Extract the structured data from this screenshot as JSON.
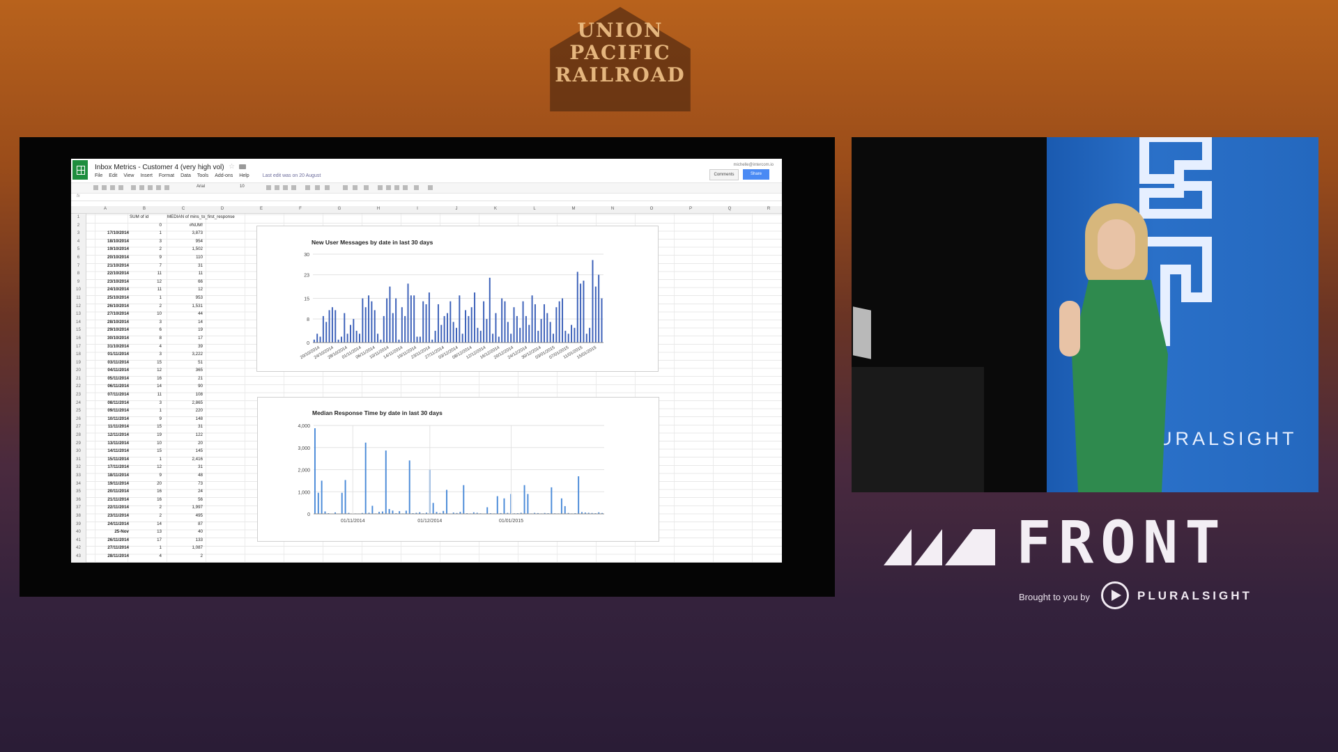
{
  "background": {
    "sign_lines": [
      "UNION",
      "PACIFIC",
      "RAILROAD"
    ]
  },
  "sheet": {
    "title": "Inbox Metrics - Customer 4 (very high vol)",
    "user": "michelle@intercom.io",
    "menu": [
      "File",
      "Edit",
      "View",
      "Insert",
      "Format",
      "Data",
      "Tools",
      "Add-ons",
      "Help"
    ],
    "last_edit": "Last edit was on 20 August",
    "comments_label": "Comments",
    "share_label": "Share",
    "font": "Arial",
    "font_size": "10",
    "fx": "fx",
    "columns": [
      "A",
      "B",
      "C",
      "D",
      "E",
      "F",
      "G",
      "H",
      "I",
      "J",
      "K",
      "L",
      "M",
      "N",
      "O",
      "P",
      "Q",
      "R"
    ],
    "header_b": "SUM of id",
    "header_c": "MEDIAN of mins_to_first_response",
    "rows": [
      {
        "n": "1",
        "a": "",
        "b": "",
        "c": ""
      },
      {
        "n": "2",
        "a": "",
        "b": "0",
        "c": "#NUM!"
      },
      {
        "n": "3",
        "a": "17/10/2014",
        "b": "1",
        "c": "3,873"
      },
      {
        "n": "4",
        "a": "18/10/2014",
        "b": "3",
        "c": "954"
      },
      {
        "n": "5",
        "a": "19/10/2014",
        "b": "2",
        "c": "1,502"
      },
      {
        "n": "6",
        "a": "20/10/2014",
        "b": "9",
        "c": "110"
      },
      {
        "n": "7",
        "a": "21/10/2014",
        "b": "7",
        "c": "31"
      },
      {
        "n": "8",
        "a": "22/10/2014",
        "b": "11",
        "c": "11"
      },
      {
        "n": "9",
        "a": "23/10/2014",
        "b": "12",
        "c": "66"
      },
      {
        "n": "10",
        "a": "24/10/2014",
        "b": "11",
        "c": "12"
      },
      {
        "n": "11",
        "a": "25/10/2014",
        "b": "1",
        "c": "953"
      },
      {
        "n": "12",
        "a": "26/10/2014",
        "b": "2",
        "c": "1,531"
      },
      {
        "n": "13",
        "a": "27/10/2014",
        "b": "10",
        "c": "44"
      },
      {
        "n": "14",
        "a": "28/10/2014",
        "b": "3",
        "c": "14"
      },
      {
        "n": "15",
        "a": "29/10/2014",
        "b": "6",
        "c": "19"
      },
      {
        "n": "16",
        "a": "30/10/2014",
        "b": "8",
        "c": "17"
      },
      {
        "n": "17",
        "a": "31/10/2014",
        "b": "4",
        "c": "39"
      },
      {
        "n": "18",
        "a": "01/11/2014",
        "b": "3",
        "c": "3,222"
      },
      {
        "n": "19",
        "a": "03/11/2014",
        "b": "15",
        "c": "51"
      },
      {
        "n": "20",
        "a": "04/11/2014",
        "b": "12",
        "c": "365"
      },
      {
        "n": "21",
        "a": "05/11/2014",
        "b": "16",
        "c": "21"
      },
      {
        "n": "22",
        "a": "06/11/2014",
        "b": "14",
        "c": "90"
      },
      {
        "n": "23",
        "a": "07/11/2014",
        "b": "11",
        "c": "108"
      },
      {
        "n": "24",
        "a": "08/11/2014",
        "b": "3",
        "c": "2,865"
      },
      {
        "n": "25",
        "a": "09/11/2014",
        "b": "1",
        "c": "220"
      },
      {
        "n": "26",
        "a": "10/11/2014",
        "b": "9",
        "c": "148"
      },
      {
        "n": "27",
        "a": "11/11/2014",
        "b": "15",
        "c": "31"
      },
      {
        "n": "28",
        "a": "12/11/2014",
        "b": "19",
        "c": "122"
      },
      {
        "n": "29",
        "a": "13/11/2014",
        "b": "10",
        "c": "20"
      },
      {
        "n": "30",
        "a": "14/11/2014",
        "b": "15",
        "c": "145"
      },
      {
        "n": "31",
        "a": "15/11/2014",
        "b": "1",
        "c": "2,416"
      },
      {
        "n": "32",
        "a": "17/11/2014",
        "b": "12",
        "c": "31"
      },
      {
        "n": "33",
        "a": "18/11/2014",
        "b": "9",
        "c": "48"
      },
      {
        "n": "34",
        "a": "19/11/2014",
        "b": "20",
        "c": "73"
      },
      {
        "n": "35",
        "a": "20/11/2014",
        "b": "16",
        "c": "24"
      },
      {
        "n": "36",
        "a": "21/11/2014",
        "b": "16",
        "c": "56"
      },
      {
        "n": "37",
        "a": "22/11/2014",
        "b": "2",
        "c": "1,997"
      },
      {
        "n": "38",
        "a": "23/11/2014",
        "b": "2",
        "c": "495"
      },
      {
        "n": "39",
        "a": "24/11/2014",
        "b": "14",
        "c": "87"
      },
      {
        "n": "40",
        "a": "25-Nov",
        "b": "13",
        "c": "40"
      },
      {
        "n": "41",
        "a": "26/11/2014",
        "b": "17",
        "c": "133"
      },
      {
        "n": "42",
        "a": "27/11/2014",
        "b": "1",
        "c": "1,087"
      },
      {
        "n": "43",
        "a": "28/11/2014",
        "b": "4",
        "c": "2"
      }
    ]
  },
  "chart_data": [
    {
      "type": "bar",
      "title": "New User Messages by date in last 30 days",
      "ylim": [
        0,
        30
      ],
      "yticks": [
        0,
        8,
        15,
        23,
        30
      ],
      "xtick_labels": [
        "20/10/2014",
        "24/10/2014",
        "28/10/2014",
        "01/11/2014",
        "06/11/2014",
        "10/11/2014",
        "14/11/2014",
        "19/11/2014",
        "23/11/2014",
        "27/11/2014",
        "03/12/2014",
        "08/12/2014",
        "12/12/2014",
        "16/12/2014",
        "20/12/2014",
        "24/12/2014",
        "30/12/2014",
        "03/01/2015",
        "07/01/2015",
        "11/01/2015",
        "15/01/2015"
      ],
      "values": [
        1,
        3,
        2,
        9,
        7,
        11,
        12,
        11,
        1,
        2,
        10,
        3,
        6,
        8,
        4,
        3,
        15,
        12,
        16,
        14,
        11,
        3,
        1,
        9,
        15,
        19,
        10,
        15,
        1,
        12,
        9,
        20,
        16,
        16,
        2,
        2,
        14,
        13,
        17,
        1,
        4,
        13,
        6,
        9,
        10,
        14,
        7,
        5,
        16,
        3,
        11,
        9,
        12,
        17,
        5,
        4,
        14,
        8,
        22,
        3,
        10,
        2,
        15,
        14,
        7,
        3,
        12,
        9,
        5,
        14,
        9,
        6,
        16,
        13,
        4,
        8,
        13,
        10,
        7,
        3,
        12,
        14,
        15,
        4,
        3,
        6,
        5,
        24,
        20,
        21,
        3,
        5,
        28,
        19,
        23,
        15
      ],
      "color": "#3a5fb8"
    },
    {
      "type": "bar",
      "title": "Median Response Time by date in last 30 days",
      "ylim": [
        0,
        4000
      ],
      "yticks": [
        0,
        1000,
        2000,
        3000,
        4000
      ],
      "ytick_labels": [
        "0",
        "1,000",
        "2,000",
        "3,000",
        "4,000"
      ],
      "xtick_labels": [
        "01/11/2014",
        "01/12/2014",
        "01/01/2015"
      ],
      "values": [
        3873,
        954,
        1502,
        110,
        31,
        11,
        66,
        12,
        953,
        1531,
        44,
        14,
        19,
        17,
        39,
        3222,
        51,
        365,
        21,
        90,
        108,
        2865,
        220,
        148,
        31,
        122,
        20,
        145,
        2416,
        31,
        48,
        73,
        24,
        56,
        1997,
        495,
        87,
        40,
        133,
        1087,
        2,
        60,
        40,
        90,
        1300,
        30,
        20,
        70,
        50,
        25,
        15,
        300,
        30,
        20,
        800,
        35,
        700,
        45,
        900,
        25,
        30,
        50,
        1300,
        900,
        20,
        45,
        35,
        20,
        40,
        30,
        1200,
        25,
        20,
        700,
        350,
        40,
        20,
        30,
        1700,
        80,
        60,
        50,
        40,
        30,
        70,
        40
      ],
      "color": "#4a8ad8"
    }
  ],
  "camera": {
    "banner_text": "URALSIGHT"
  },
  "branding": {
    "front": "FRONT",
    "brought_by": "Brought to you by",
    "pluralsight": "PLURALSIGHT"
  }
}
